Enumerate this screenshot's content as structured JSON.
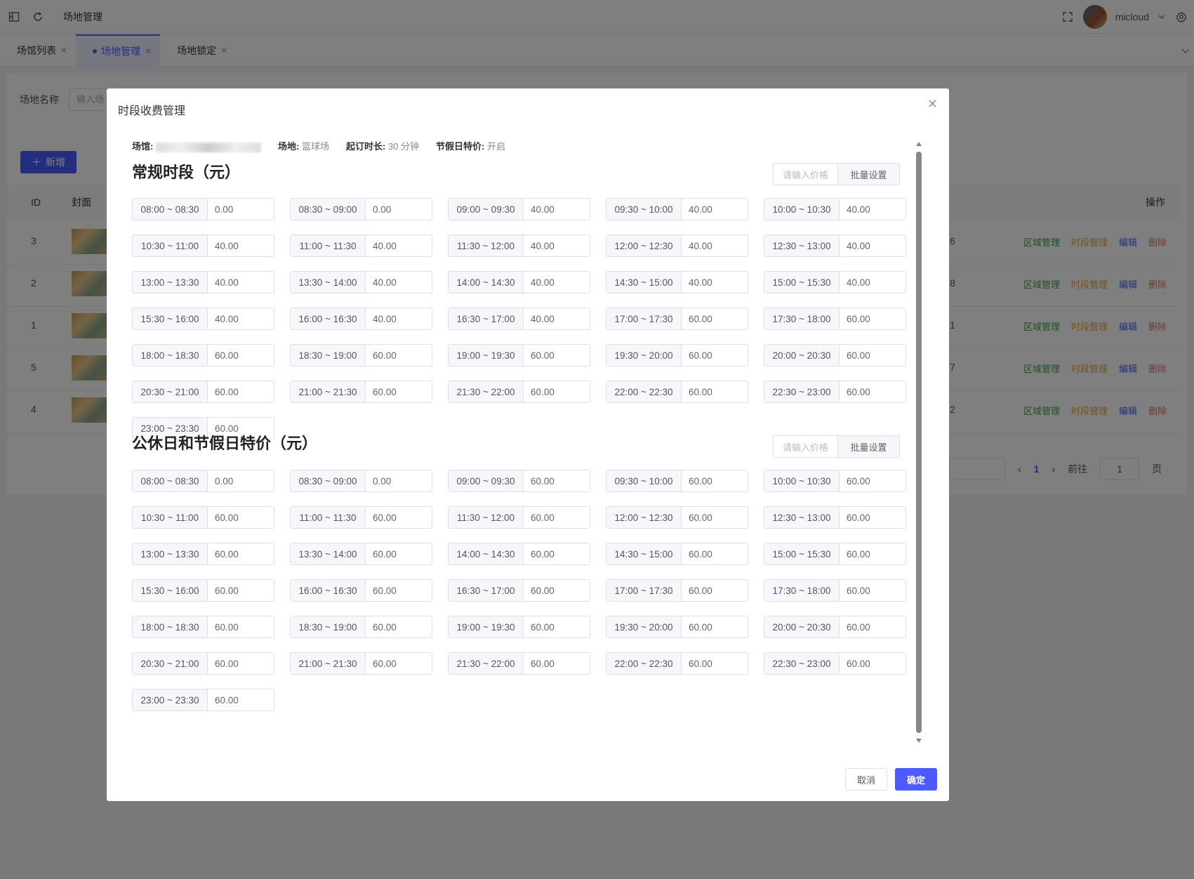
{
  "topbar": {
    "title": "场地管理",
    "user": "micloud"
  },
  "tabs": [
    {
      "label": "场馆列表",
      "active": false
    },
    {
      "label": "场地管理",
      "active": true
    },
    {
      "label": "场地锁定",
      "active": false
    }
  ],
  "page": {
    "search_label": "场地名称",
    "search_placeholder": "输入场",
    "add_label": "新增",
    "columns": {
      "id": "ID",
      "cover": "封面",
      "ops": "操作"
    },
    "rows": [
      {
        "id": "3",
        "tail": "6"
      },
      {
        "id": "2",
        "tail": "8"
      },
      {
        "id": "1",
        "tail": "1"
      },
      {
        "id": "5",
        "tail": "7"
      },
      {
        "id": "4",
        "tail": "2"
      }
    ],
    "row_ops": [
      "区域管理",
      "时段管理",
      "编辑",
      "删除"
    ],
    "pager": {
      "current": "1",
      "goto_label": "前往",
      "goto_value": "1",
      "page_suffix": "页"
    }
  },
  "dialog": {
    "title": "时段收费管理",
    "info": {
      "venue_label": "场馆:",
      "site_label": "场地:",
      "site_value": "篮球场",
      "min_label": "起订时长:",
      "min_value": "30 分钟",
      "holiday_label": "节假日特价:",
      "holiday_value": "开启"
    },
    "regular": {
      "title": "常规时段（元）",
      "batch_placeholder": "请输入价格",
      "batch_button": "批量设置",
      "slots": [
        {
          "t": "08:00 ~ 08:30",
          "p": "0.00"
        },
        {
          "t": "08:30 ~ 09:00",
          "p": "0.00"
        },
        {
          "t": "09:00 ~ 09:30",
          "p": "40.00"
        },
        {
          "t": "09:30 ~ 10:00",
          "p": "40.00"
        },
        {
          "t": "10:00 ~ 10:30",
          "p": "40.00"
        },
        {
          "t": "10:30 ~ 11:00",
          "p": "40.00"
        },
        {
          "t": "11:00 ~ 11:30",
          "p": "40.00"
        },
        {
          "t": "11:30 ~ 12:00",
          "p": "40.00"
        },
        {
          "t": "12:00 ~ 12:30",
          "p": "40.00"
        },
        {
          "t": "12:30 ~ 13:00",
          "p": "40.00"
        },
        {
          "t": "13:00 ~ 13:30",
          "p": "40.00"
        },
        {
          "t": "13:30 ~ 14:00",
          "p": "40.00"
        },
        {
          "t": "14:00 ~ 14:30",
          "p": "40.00"
        },
        {
          "t": "14:30 ~ 15:00",
          "p": "40.00"
        },
        {
          "t": "15:00 ~ 15:30",
          "p": "40.00"
        },
        {
          "t": "15:30 ~ 16:00",
          "p": "40.00"
        },
        {
          "t": "16:00 ~ 16:30",
          "p": "40.00"
        },
        {
          "t": "16:30 ~ 17:00",
          "p": "40.00"
        },
        {
          "t": "17:00 ~ 17:30",
          "p": "60.00"
        },
        {
          "t": "17:30 ~ 18:00",
          "p": "60.00"
        },
        {
          "t": "18:00 ~ 18:30",
          "p": "60.00"
        },
        {
          "t": "18:30 ~ 19:00",
          "p": "60.00"
        },
        {
          "t": "19:00 ~ 19:30",
          "p": "60.00"
        },
        {
          "t": "19:30 ~ 20:00",
          "p": "60.00"
        },
        {
          "t": "20:00 ~ 20:30",
          "p": "60.00"
        },
        {
          "t": "20:30 ~ 21:00",
          "p": "60.00"
        },
        {
          "t": "21:00 ~ 21:30",
          "p": "60.00"
        },
        {
          "t": "21:30 ~ 22:00",
          "p": "60.00"
        },
        {
          "t": "22:00 ~ 22:30",
          "p": "60.00"
        },
        {
          "t": "22:30 ~ 23:00",
          "p": "60.00"
        },
        {
          "t": "23:00 ~ 23:30",
          "p": "60.00"
        }
      ]
    },
    "holiday": {
      "title": "公休日和节假日特价（元）",
      "batch_placeholder": "请输入价格",
      "batch_button": "批量设置",
      "slots": [
        {
          "t": "08:00 ~ 08:30",
          "p": "0.00"
        },
        {
          "t": "08:30 ~ 09:00",
          "p": "0.00"
        },
        {
          "t": "09:00 ~ 09:30",
          "p": "60.00"
        },
        {
          "t": "09:30 ~ 10:00",
          "p": "60.00"
        },
        {
          "t": "10:00 ~ 10:30",
          "p": "60.00"
        },
        {
          "t": "10:30 ~ 11:00",
          "p": "60.00"
        },
        {
          "t": "11:00 ~ 11:30",
          "p": "60.00"
        },
        {
          "t": "11:30 ~ 12:00",
          "p": "60.00"
        },
        {
          "t": "12:00 ~ 12:30",
          "p": "60.00"
        },
        {
          "t": "12:30 ~ 13:00",
          "p": "60.00"
        },
        {
          "t": "13:00 ~ 13:30",
          "p": "60.00"
        },
        {
          "t": "13:30 ~ 14:00",
          "p": "60.00"
        },
        {
          "t": "14:00 ~ 14:30",
          "p": "60.00"
        },
        {
          "t": "14:30 ~ 15:00",
          "p": "60.00"
        },
        {
          "t": "15:00 ~ 15:30",
          "p": "60.00"
        },
        {
          "t": "15:30 ~ 16:00",
          "p": "60.00"
        },
        {
          "t": "16:00 ~ 16:30",
          "p": "60.00"
        },
        {
          "t": "16:30 ~ 17:00",
          "p": "60.00"
        },
        {
          "t": "17:00 ~ 17:30",
          "p": "60.00"
        },
        {
          "t": "17:30 ~ 18:00",
          "p": "60.00"
        },
        {
          "t": "18:00 ~ 18:30",
          "p": "60.00"
        },
        {
          "t": "18:30 ~ 19:00",
          "p": "60.00"
        },
        {
          "t": "19:00 ~ 19:30",
          "p": "60.00"
        },
        {
          "t": "19:30 ~ 20:00",
          "p": "60.00"
        },
        {
          "t": "20:00 ~ 20:30",
          "p": "60.00"
        },
        {
          "t": "20:30 ~ 21:00",
          "p": "60.00"
        },
        {
          "t": "21:00 ~ 21:30",
          "p": "60.00"
        },
        {
          "t": "21:30 ~ 22:00",
          "p": "60.00"
        },
        {
          "t": "22:00 ~ 22:30",
          "p": "60.00"
        },
        {
          "t": "22:30 ~ 23:00",
          "p": "60.00"
        },
        {
          "t": "23:00 ~ 23:30",
          "p": "60.00"
        }
      ]
    },
    "cancel_label": "取消",
    "ok_label": "确定"
  },
  "colors": {
    "accent": "#4b5bff",
    "area_op": "#3aa14a",
    "time_op": "#e6a23c",
    "delete_op": "#f56c6c"
  }
}
